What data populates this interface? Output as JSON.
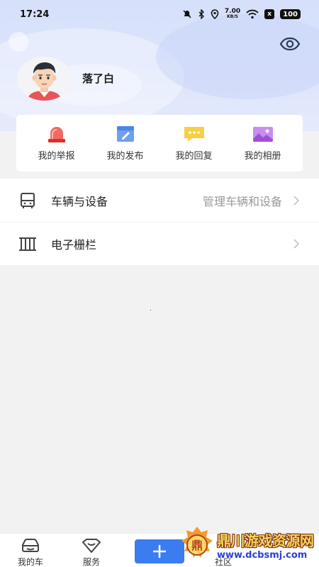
{
  "status_bar": {
    "time": "17:24",
    "net_speed_value": "7.00",
    "net_speed_unit": "KB/S",
    "sim_label": "x",
    "battery": "100"
  },
  "profile": {
    "username": "落了白"
  },
  "quick_actions": [
    {
      "label": "我的举报",
      "icon": "alarm-light-icon",
      "color": "#e8413c"
    },
    {
      "label": "我的发布",
      "icon": "edit-document-icon",
      "color": "#4a86e8"
    },
    {
      "label": "我的回复",
      "icon": "reply-bubble-icon",
      "color": "#f5c531"
    },
    {
      "label": "我的相册",
      "icon": "photo-album-icon",
      "color": "#b85fe0"
    }
  ],
  "menu": [
    {
      "label": "车辆与设备",
      "hint": "管理车辆和设备",
      "icon": "vehicle-device-icon"
    },
    {
      "label": "电子栅栏",
      "hint": "",
      "icon": "fence-icon"
    }
  ],
  "tabs": [
    {
      "label": "我的车",
      "icon": "car-icon"
    },
    {
      "label": "服务",
      "icon": "service-heart-icon"
    },
    {
      "label": "+",
      "icon": "plus-icon"
    }
  ],
  "tab_partial": "社区",
  "watermark": {
    "title": "鼎川游戏资源网",
    "url": "www.dcbsmj.com"
  },
  "colors": {
    "accent": "#3b7cf0",
    "header_gradient": "#d6e0fb"
  }
}
